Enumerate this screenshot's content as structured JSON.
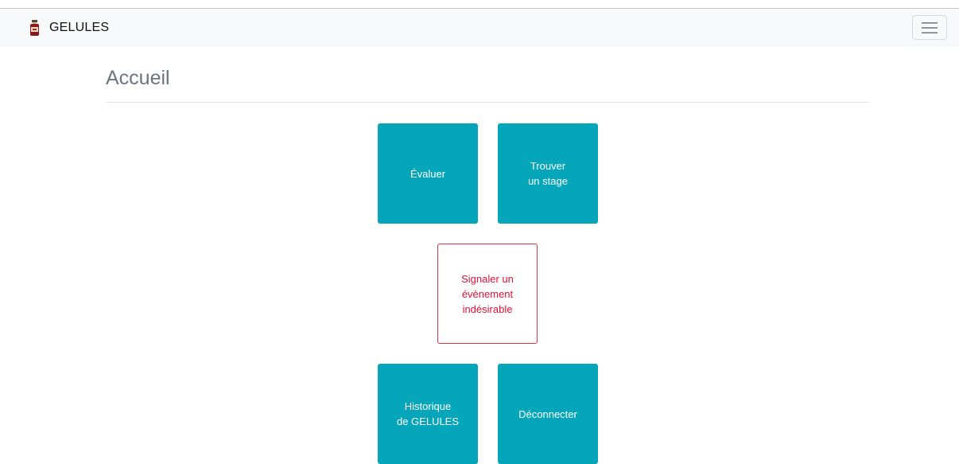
{
  "app": {
    "brand_name": "GELULES",
    "logo_icon": "medicine-bottle-icon",
    "menu_icon": "hamburger-menu-icon"
  },
  "page": {
    "title": "Accueil"
  },
  "tiles": {
    "evaluate": "Évaluer",
    "find_internship": "Trouver\nun stage",
    "report_event": "Signaler un\névènement\nindésirable",
    "history": "Historique\nde GELULES",
    "logout": "Déconnecter"
  },
  "colors": {
    "primary_tile": "#05a5ba",
    "danger": "#dc3545",
    "navbar_bg": "#f8f9fa"
  }
}
